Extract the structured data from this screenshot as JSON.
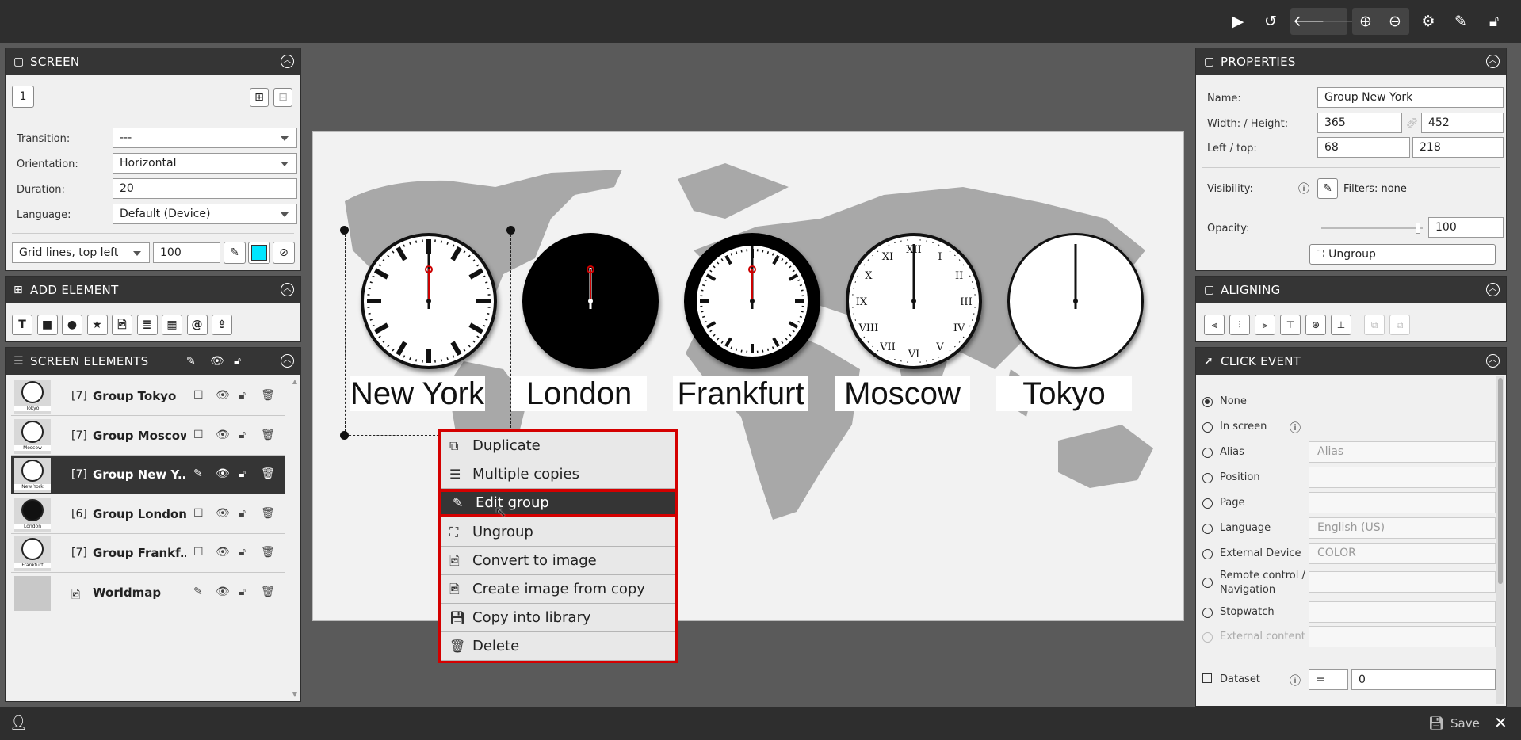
{
  "toolbar": {
    "icons": [
      "play-icon",
      "reload-icon",
      "back-icon",
      "forward-icon",
      "zoom-in-icon",
      "zoom-out-icon",
      "gear-icon",
      "edit-icon",
      "lock-icon"
    ]
  },
  "screen": {
    "title": "SCREEN",
    "number": "1",
    "transition_label": "Transition:",
    "transition_value": "---",
    "orientation_label": "Orientation:",
    "orientation_value": "Horizontal",
    "duration_label": "Duration:",
    "duration_value": "20",
    "language_label": "Language:",
    "language_value": "Default (Device)",
    "grid_value": "Grid lines, top left",
    "grid_size": "100",
    "accent_color": "#00e5ff"
  },
  "add_element": {
    "title": "ADD ELEMENT",
    "tools": [
      "T",
      "■",
      "●",
      "★",
      "🖻",
      "≣",
      "▦",
      "@",
      "⇪"
    ]
  },
  "screen_elements": {
    "title": "SCREEN ELEMENTS",
    "items": [
      {
        "count": "[7]",
        "name": "Group Tokyo",
        "thumb_label": "Tokyo"
      },
      {
        "count": "[7]",
        "name": "Group Moscow",
        "thumb_label": "Moscow"
      },
      {
        "count": "[7]",
        "name": "Group New Y...",
        "thumb_label": "New York"
      },
      {
        "count": "[6]",
        "name": "Group London",
        "thumb_label": "London"
      },
      {
        "count": "[7]",
        "name": "Group Frankf...",
        "thumb_label": "Frankfurt"
      },
      {
        "count": "",
        "name": "Worldmap",
        "thumb_label": ""
      }
    ]
  },
  "canvas": {
    "cities": [
      "New York",
      "London",
      "Frankfurt",
      "Moscow",
      "Tokyo"
    ]
  },
  "context_menu": {
    "items": [
      "Duplicate",
      "Multiple copies",
      "Edit group",
      "Ungroup",
      "Convert to image",
      "Create image from copy",
      "Copy into library",
      "Delete"
    ],
    "highlighted": "Edit group"
  },
  "properties": {
    "title": "PROPERTIES",
    "name_label": "Name:",
    "name_value": "Group New York",
    "wh_label": "Width: / Height:",
    "width": "365",
    "height": "452",
    "lt_label": "Left / top:",
    "left": "68",
    "top": "218",
    "visibility_label": "Visibility:",
    "filters": "Filters: none",
    "opacity_label": "Opacity:",
    "opacity_value": "100",
    "opacity_fraction": 0.95,
    "ungroup": "Ungroup"
  },
  "aligning": {
    "title": "ALIGNING"
  },
  "click_event": {
    "title": "CLICK EVENT",
    "options": [
      {
        "label": "None",
        "value": "",
        "selected": true
      },
      {
        "label": "In screen",
        "value": ""
      },
      {
        "label": "Alias",
        "value": "Alias"
      },
      {
        "label": "Position",
        "value": ""
      },
      {
        "label": "Page",
        "value": ""
      },
      {
        "label": "Language",
        "value": "English (US)"
      },
      {
        "label": "External Device",
        "value": "COLOR"
      },
      {
        "label": "Remote control / Navigation",
        "value": ""
      },
      {
        "label": "Stopwatch",
        "value": ""
      },
      {
        "label": "External content",
        "value": ""
      }
    ],
    "dataset_label": "Dataset",
    "dataset_op": "=",
    "dataset_value": "0"
  },
  "bottom": {
    "save": "Save"
  }
}
